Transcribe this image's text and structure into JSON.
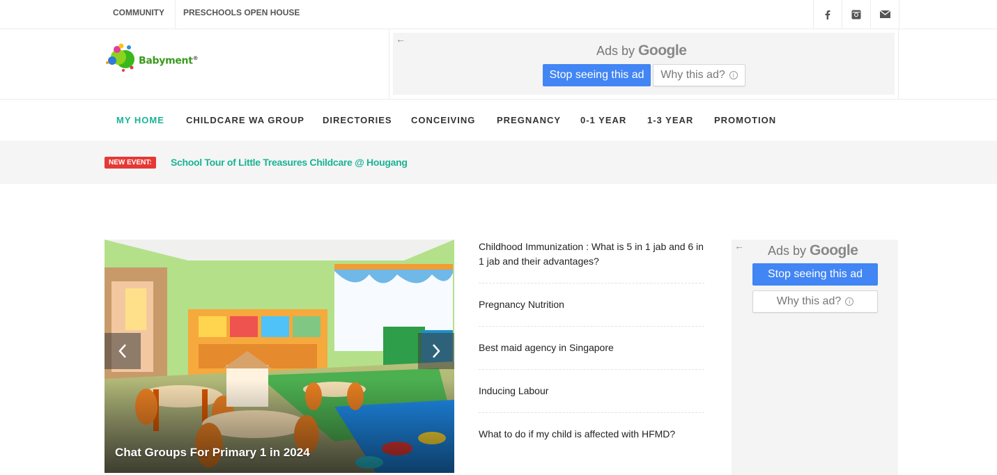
{
  "topbar": {
    "links": [
      "COMMUNITY",
      "PRESCHOOLS OPEN HOUSE"
    ],
    "social_icons": [
      "facebook-icon",
      "instagram-icon",
      "mail-icon"
    ]
  },
  "logo": {
    "text": "Babyment",
    "reg": "®"
  },
  "ad_top": {
    "ads_by": "Ads by",
    "google": "Google",
    "stop": "Stop seeing this ad",
    "why": "Why this ad?"
  },
  "nav": {
    "items": [
      "MY HOME",
      "CHILDCARE WA GROUP",
      "DIRECTORIES",
      "CONCEIVING",
      "PREGNANCY",
      "0-1 YEAR",
      "1-3 YEAR",
      "PROMOTION"
    ],
    "active": "MY HOME",
    "accent": "#19b394"
  },
  "event": {
    "badge": "NEW EVENT:",
    "title": "School Tour of Little Treasures Childcare @ Hougang"
  },
  "slider": {
    "caption": "Chat Groups For Primary 1 in 2024"
  },
  "articles": [
    "Childhood Immunization : What is 5 in 1 jab and 6 in 1 jab and their advantages?",
    "Pregnancy Nutrition",
    "Best maid agency in Singapore",
    "Inducing Labour",
    "What to do if my child is affected with HFMD?"
  ],
  "ad_side": {
    "ads_by": "Ads by",
    "google": "Google",
    "stop": "Stop seeing this ad",
    "why": "Why this ad?"
  },
  "colors": {
    "accent": "#19b394",
    "badge": "#e53935",
    "ad_button": "#4285f4"
  }
}
